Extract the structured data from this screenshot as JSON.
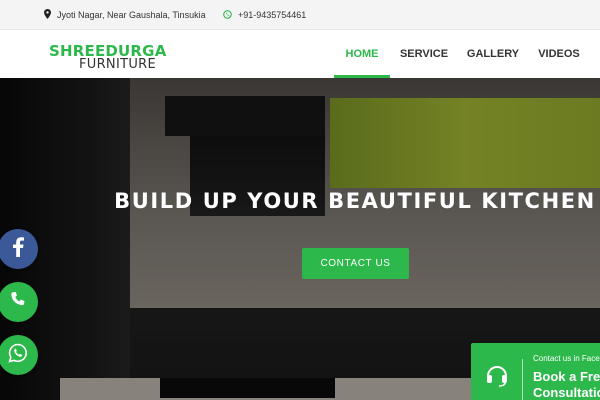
{
  "topbar": {
    "address": "Jyoti Nagar, Near Gaushala, Tinsukia",
    "phone": "+91-9435754461",
    "address_icon": "map-pin-icon",
    "phone_icon": "whatsapp-icon"
  },
  "brand": {
    "line1": "SHREEDURGA",
    "line2": "FURNITURE",
    "accent_color": "#2db84c"
  },
  "nav": {
    "items": [
      "HOME",
      "SERVICE",
      "GALLERY",
      "VIDEOS"
    ],
    "active": "HOME"
  },
  "hero": {
    "headline": "BUILD UP YOUR BEAUTIFUL KITCHEN",
    "cta_label": "CONTACT US"
  },
  "social": {
    "facebook_icon": "facebook-icon",
    "call_icon": "phone-icon",
    "whatsapp_icon": "whatsapp-icon",
    "facebook_color": "#3b5998"
  },
  "consult": {
    "small": "Contact us in Faceb",
    "big_line1": "Book a Free",
    "big_line2": "Consultation",
    "icon": "headset-icon"
  }
}
